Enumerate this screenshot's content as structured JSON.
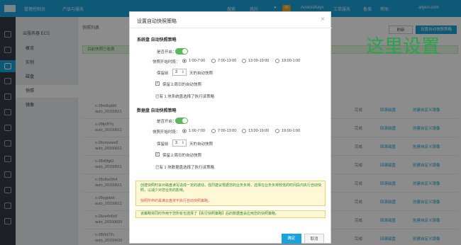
{
  "topbar": {
    "console": "管理控制台",
    "products": "产品与服务",
    "search": "搜索",
    "mine": "我的",
    "badge_count": "99",
    "accesskeys": "AccessKeys",
    "tickets": "工单服务",
    "record": "备案",
    "help": "帮助",
    "account": "aliyun.com"
  },
  "subnav": {
    "title": "云服务器 ECS",
    "items": [
      "概览",
      "实例",
      "磁盘",
      "快照",
      "镜像"
    ],
    "selected": "快照"
  },
  "main": {
    "tab": "快照列表",
    "refresh": "刷新",
    "create_policy": "设置自动快照策略",
    "tip": "目前快照已收费",
    "rows": [
      {
        "name": "s-28m8ujbt0",
        "date": "auto_20150611",
        "status": "完成",
        "link": "回滚磁盘",
        "link2": "创建自定义镜像"
      },
      {
        "name": "s-28fp3f7rj",
        "date": "auto_20150611",
        "status": "完成",
        "link": "回滚磁盘",
        "link2": "创建自定义镜像"
      },
      {
        "name": "s-28cnuwze8",
        "date": "auto_20150611",
        "status": "完成",
        "link": "回滚磁盘",
        "link2": "创建自定义镜像"
      },
      {
        "name": "s-28d0fgk1",
        "date": "auto_20150611",
        "status": "完成",
        "link": "回滚磁盘",
        "link2": "创建自定义镜像"
      },
      {
        "name": "s-28u5w2th4",
        "date": "auto_20150611",
        "status": "完成",
        "link": "回滚磁盘",
        "link2": "创建自定义镜像"
      },
      {
        "name": "s-28cgpkxh",
        "date": "auto_20150611",
        "status": "完成",
        "link": "回滚磁盘",
        "link2": "创建自定义镜像"
      },
      {
        "name": "s-28ce4h6z5",
        "date": "auto_20150609",
        "status": "完成",
        "link": "回滚磁盘",
        "link2": "创建自定义镜像"
      },
      {
        "name": "s-28t3d72c",
        "date": "auto_20150609",
        "status": "完成",
        "link": "回滚磁盘",
        "link2": "创建自定义镜像"
      }
    ]
  },
  "modal": {
    "title": "设置自动快照策略",
    "close": "×",
    "system_disk": {
      "section": "系统盘  自动快照策略",
      "enable_label": "是否开启：",
      "timeslot_label": "快照开始时段：",
      "slots": [
        "1:00-7:00",
        "7:00-13:00",
        "13:00-19:00",
        "19:00-1:00"
      ],
      "selected_slot": "1:00-7:00",
      "keep_label": "保留前",
      "keep_value": "3",
      "keep_suffix": "天的自动快照",
      "keep_last_label": "保留上周日的自动快照",
      "summary": "已有 1 块系统盘选择了执行该策略"
    },
    "data_disk": {
      "section": "数据盘  自动快照策略",
      "enable_label": "是否开启：",
      "timeslot_label": "快照开始时段：",
      "slots": [
        "1:00-7:00",
        "7:00-13:00",
        "13:00-19:00",
        "19:00-1:00"
      ],
      "selected_slot": "1:00-7:00",
      "keep_label": "保留前",
      "keep_value": "3",
      "keep_suffix": "天的自动快照",
      "keep_last_label": "保留上周日的自动快照",
      "summary": "已有 1 块数据盘选择了执行该策略"
    },
    "warning_1": "创建快照时会对磁盘读写造成一定的波动，强烈建议根据您的业务负荷，选择在业务负荷较低的时间段内执行自动快照，以减少对您业务的影响。",
    "warning_2": "快照所申的最满云盘将不执行自动快照策略。",
    "note": "该策略将同时作用于您所有也选择了【执行快照策略】后的数据盘会应用您的快照策略。",
    "ok": "确定",
    "cancel": "取消"
  },
  "annotation": "这里设置"
}
